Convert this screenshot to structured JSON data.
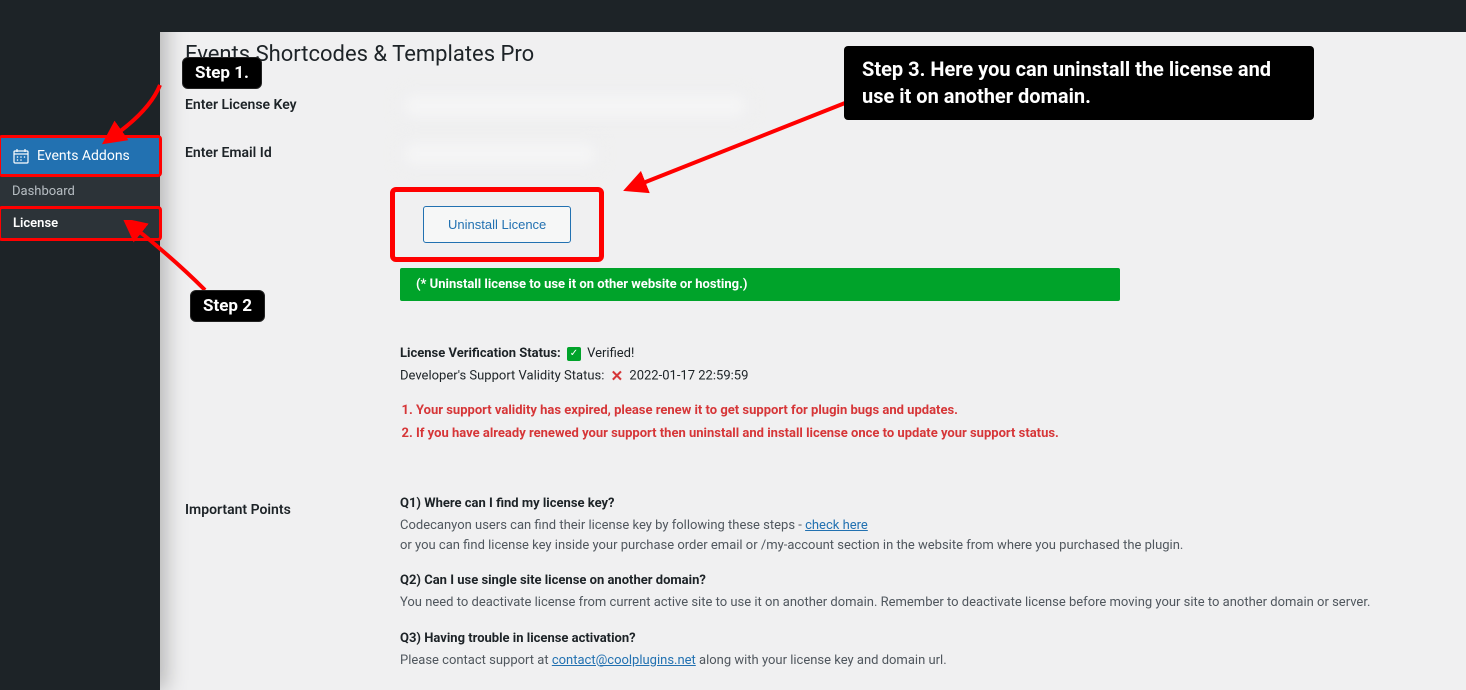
{
  "sidebar": {
    "main_item": "Events Addons",
    "sub_items": [
      "Dashboard",
      "License"
    ]
  },
  "page": {
    "title": "Events Shortcodes & Templates Pro",
    "labels": {
      "license_key": "Enter License Key",
      "email": "Enter Email Id",
      "important": "Important Points"
    },
    "uninstall_button": "Uninstall Licence",
    "green_notice": "(* Uninstall license to use it on other website or hosting.)",
    "status": {
      "verification_label": "License Verification Status:",
      "verification_value": "Verified!",
      "support_label": "Developer's Support Validity Status:",
      "support_value": "2022-01-17 22:59:59"
    },
    "warnings": [
      "Your support validity has expired, please renew it to get support for plugin bugs and updates.",
      "If you have already renewed your support then uninstall and install license once to update your support status."
    ],
    "faq": {
      "q1": "Q1) Where can I find my license key?",
      "a1_part1": "Codecanyon users can find their license key by following these steps - ",
      "a1_link": "check here",
      "a1_part2": "or you can find license key inside your purchase order email or /my-account section in the website from where you purchased the plugin.",
      "q2": "Q2) Can I use single site license on another domain?",
      "a2": "You need to deactivate license from current active site to use it on another domain. Remember to deactivate license before moving your site to another domain or server.",
      "q3": "Q3) Having trouble in license activation?",
      "a3_part1": "Please contact support at ",
      "a3_link": "contact@coolplugins.net",
      "a3_part2": " along with your license key and domain url."
    }
  },
  "annotations": {
    "step1": "Step 1.",
    "step2": "Step 2",
    "step3": "Step 3. Here you can uninstall the license and use it on another domain."
  }
}
